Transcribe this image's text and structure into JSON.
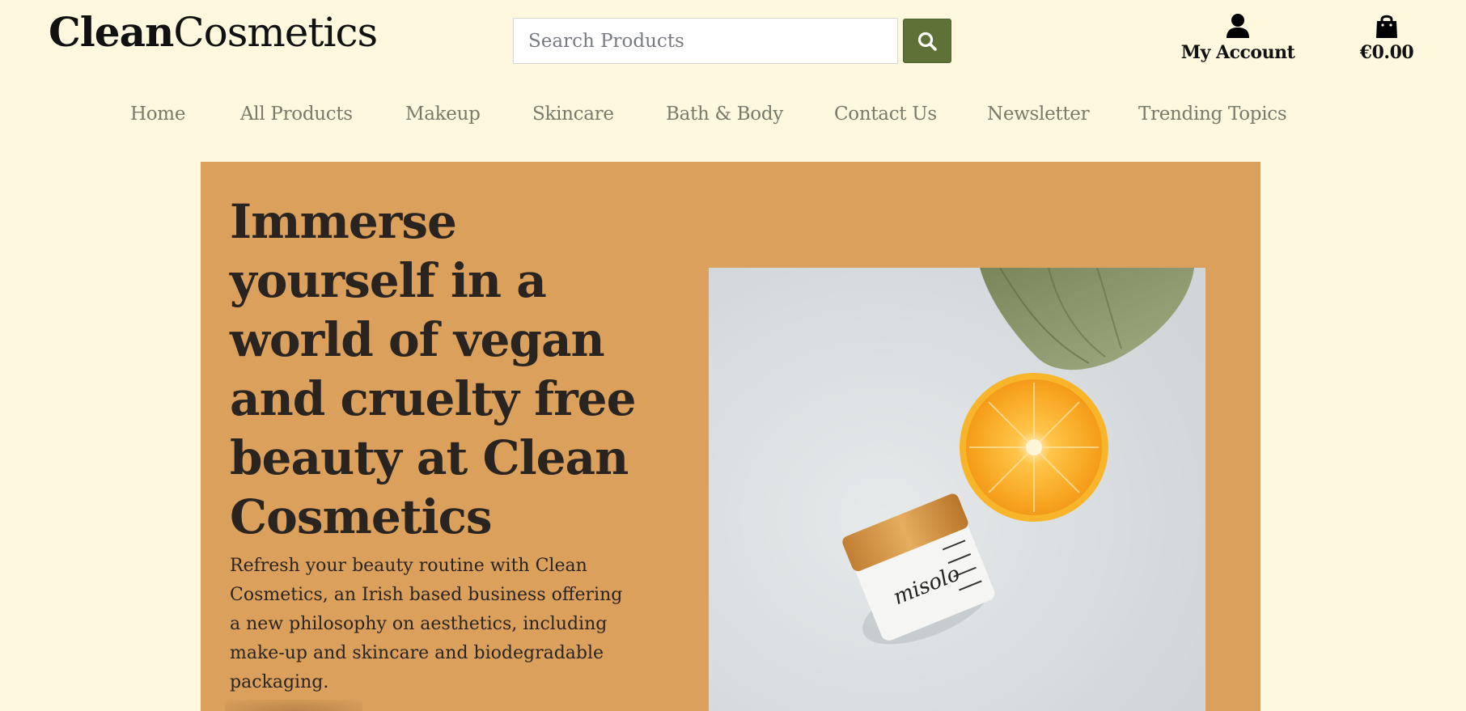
{
  "header": {
    "logo_bold": "Clean",
    "logo_light": "Cosmetics",
    "search_placeholder": "Search Products",
    "account_label": "My Account",
    "bag_total": "€0.00"
  },
  "nav": {
    "items": [
      {
        "label": "Home"
      },
      {
        "label": "All Products"
      },
      {
        "label": "Makeup"
      },
      {
        "label": "Skincare"
      },
      {
        "label": "Bath & Body"
      },
      {
        "label": "Contact Us"
      },
      {
        "label": "Newsletter"
      },
      {
        "label": "Trending Topics"
      }
    ]
  },
  "hero": {
    "title": "Immerse yourself in a world of vegan and cruelty free beauty at Clean Cosmetics",
    "text": "Refresh your beauty routine with Clean Cosmetics, an Irish based business offering a new philosophy on aesthetics, including make-up and skincare and biodegradable packaging.",
    "jar_brand": "misolo"
  },
  "colors": {
    "page_background": "#fdf8de",
    "hero_background": "#dba05c",
    "search_button": "#5e7238",
    "nav_text": "#7a7a6a"
  },
  "icons": {
    "search": "search-icon",
    "account": "user-icon",
    "bag": "shopping-bag-icon"
  }
}
